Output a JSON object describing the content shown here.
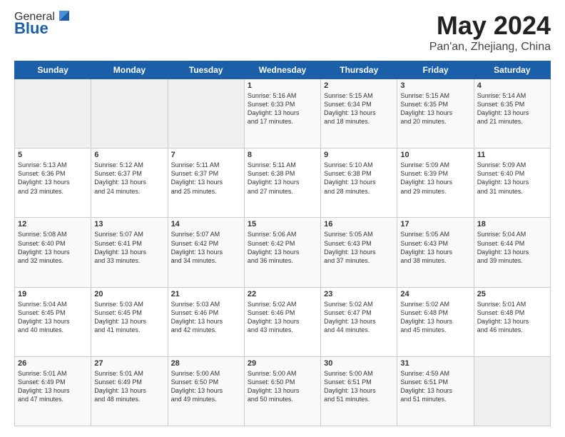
{
  "header": {
    "logo_general": "General",
    "logo_blue": "Blue",
    "main_title": "May 2024",
    "sub_title": "Pan'an, Zhejiang, China"
  },
  "days_of_week": [
    "Sunday",
    "Monday",
    "Tuesday",
    "Wednesday",
    "Thursday",
    "Friday",
    "Saturday"
  ],
  "weeks": [
    [
      {
        "day": "",
        "info": ""
      },
      {
        "day": "",
        "info": ""
      },
      {
        "day": "",
        "info": ""
      },
      {
        "day": "1",
        "info": "Sunrise: 5:16 AM\nSunset: 6:33 PM\nDaylight: 13 hours\nand 17 minutes."
      },
      {
        "day": "2",
        "info": "Sunrise: 5:15 AM\nSunset: 6:34 PM\nDaylight: 13 hours\nand 18 minutes."
      },
      {
        "day": "3",
        "info": "Sunrise: 5:15 AM\nSunset: 6:35 PM\nDaylight: 13 hours\nand 20 minutes."
      },
      {
        "day": "4",
        "info": "Sunrise: 5:14 AM\nSunset: 6:35 PM\nDaylight: 13 hours\nand 21 minutes."
      }
    ],
    [
      {
        "day": "5",
        "info": "Sunrise: 5:13 AM\nSunset: 6:36 PM\nDaylight: 13 hours\nand 23 minutes."
      },
      {
        "day": "6",
        "info": "Sunrise: 5:12 AM\nSunset: 6:37 PM\nDaylight: 13 hours\nand 24 minutes."
      },
      {
        "day": "7",
        "info": "Sunrise: 5:11 AM\nSunset: 6:37 PM\nDaylight: 13 hours\nand 25 minutes."
      },
      {
        "day": "8",
        "info": "Sunrise: 5:11 AM\nSunset: 6:38 PM\nDaylight: 13 hours\nand 27 minutes."
      },
      {
        "day": "9",
        "info": "Sunrise: 5:10 AM\nSunset: 6:38 PM\nDaylight: 13 hours\nand 28 minutes."
      },
      {
        "day": "10",
        "info": "Sunrise: 5:09 AM\nSunset: 6:39 PM\nDaylight: 13 hours\nand 29 minutes."
      },
      {
        "day": "11",
        "info": "Sunrise: 5:09 AM\nSunset: 6:40 PM\nDaylight: 13 hours\nand 31 minutes."
      }
    ],
    [
      {
        "day": "12",
        "info": "Sunrise: 5:08 AM\nSunset: 6:40 PM\nDaylight: 13 hours\nand 32 minutes."
      },
      {
        "day": "13",
        "info": "Sunrise: 5:07 AM\nSunset: 6:41 PM\nDaylight: 13 hours\nand 33 minutes."
      },
      {
        "day": "14",
        "info": "Sunrise: 5:07 AM\nSunset: 6:42 PM\nDaylight: 13 hours\nand 34 minutes."
      },
      {
        "day": "15",
        "info": "Sunrise: 5:06 AM\nSunset: 6:42 PM\nDaylight: 13 hours\nand 36 minutes."
      },
      {
        "day": "16",
        "info": "Sunrise: 5:05 AM\nSunset: 6:43 PM\nDaylight: 13 hours\nand 37 minutes."
      },
      {
        "day": "17",
        "info": "Sunrise: 5:05 AM\nSunset: 6:43 PM\nDaylight: 13 hours\nand 38 minutes."
      },
      {
        "day": "18",
        "info": "Sunrise: 5:04 AM\nSunset: 6:44 PM\nDaylight: 13 hours\nand 39 minutes."
      }
    ],
    [
      {
        "day": "19",
        "info": "Sunrise: 5:04 AM\nSunset: 6:45 PM\nDaylight: 13 hours\nand 40 minutes."
      },
      {
        "day": "20",
        "info": "Sunrise: 5:03 AM\nSunset: 6:45 PM\nDaylight: 13 hours\nand 41 minutes."
      },
      {
        "day": "21",
        "info": "Sunrise: 5:03 AM\nSunset: 6:46 PM\nDaylight: 13 hours\nand 42 minutes."
      },
      {
        "day": "22",
        "info": "Sunrise: 5:02 AM\nSunset: 6:46 PM\nDaylight: 13 hours\nand 43 minutes."
      },
      {
        "day": "23",
        "info": "Sunrise: 5:02 AM\nSunset: 6:47 PM\nDaylight: 13 hours\nand 44 minutes."
      },
      {
        "day": "24",
        "info": "Sunrise: 5:02 AM\nSunset: 6:48 PM\nDaylight: 13 hours\nand 45 minutes."
      },
      {
        "day": "25",
        "info": "Sunrise: 5:01 AM\nSunset: 6:48 PM\nDaylight: 13 hours\nand 46 minutes."
      }
    ],
    [
      {
        "day": "26",
        "info": "Sunrise: 5:01 AM\nSunset: 6:49 PM\nDaylight: 13 hours\nand 47 minutes."
      },
      {
        "day": "27",
        "info": "Sunrise: 5:01 AM\nSunset: 6:49 PM\nDaylight: 13 hours\nand 48 minutes."
      },
      {
        "day": "28",
        "info": "Sunrise: 5:00 AM\nSunset: 6:50 PM\nDaylight: 13 hours\nand 49 minutes."
      },
      {
        "day": "29",
        "info": "Sunrise: 5:00 AM\nSunset: 6:50 PM\nDaylight: 13 hours\nand 50 minutes."
      },
      {
        "day": "30",
        "info": "Sunrise: 5:00 AM\nSunset: 6:51 PM\nDaylight: 13 hours\nand 51 minutes."
      },
      {
        "day": "31",
        "info": "Sunrise: 4:59 AM\nSunset: 6:51 PM\nDaylight: 13 hours\nand 51 minutes."
      },
      {
        "day": "",
        "info": ""
      }
    ]
  ]
}
